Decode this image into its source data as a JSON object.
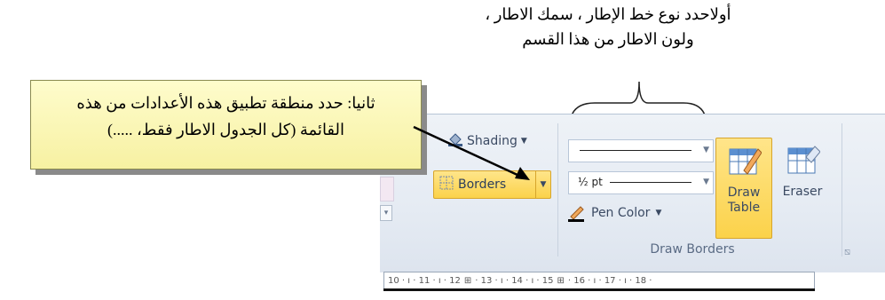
{
  "annotations": {
    "top_line1": "أولاحدد نوع خط الإطار ، سمك الاطار ،",
    "top_line2": "ولون الاطار من هذا القسم",
    "callout_line1": "ثانيا: حدد منطقة تطبيق هذه الأعدادات من هذه",
    "callout_line2": "القائمة (كل الجدول الاطار فقط، .....)"
  },
  "ribbon": {
    "shading_label": "Shading",
    "borders_label": "Borders",
    "pen_weight": "½ pt",
    "pen_color_label": "Pen Color",
    "draw_table_line1": "Draw",
    "draw_table_line2": "Table",
    "eraser_label": "Eraser",
    "group_label": "Draw Borders"
  },
  "ruler": {
    "marks": "10 · ı · 11 · ı · 12",
    "marks2": "· 13 · ı · 14 · ı · 15",
    "marks3": "· 16 · ı · 17 · ı · 18 ·"
  },
  "icons": {
    "shading": "paint-bucket-icon",
    "borders": "borders-grid-icon",
    "pen": "pen-icon",
    "draw_table": "pencil-table-icon",
    "eraser": "eraser-table-icon",
    "launcher": "dialog-launcher-icon"
  },
  "colors": {
    "accent_highlight": "#fbd24a",
    "callout_bg": "#fefccc",
    "ribbon_bg": "#e5ebf3"
  }
}
